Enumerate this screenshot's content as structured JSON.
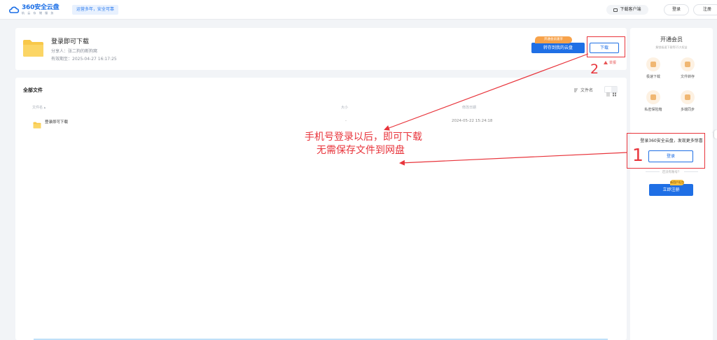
{
  "header": {
    "logo_text": "360安全云盘",
    "logo_sub": "杭 云 存 储 服 务",
    "slogan": "运营多年，安全可靠",
    "download_client": "下载客户端",
    "login_label": "登录",
    "register_label": "注册"
  },
  "share": {
    "title": "登录即可下载",
    "sharer": "分享人：张二狗的断狗窝",
    "expiry": "有效期至：2025-04-27 16:17:25",
    "vip_tag": "开通会员速享",
    "save_button": "转存到我的云盘",
    "download_button": "下载",
    "report": "举报"
  },
  "files": {
    "title": "全部文件",
    "sort_label": "文件名",
    "columns": [
      "文件名",
      "大小",
      "修改日期"
    ],
    "rows": [
      {
        "name": "登录即可下载",
        "size": "-",
        "date": "2024-05-22 15:24:18"
      }
    ]
  },
  "vip_panel": {
    "title": "开通会员",
    "subtitle": "解锁极速下载等15大权益",
    "features": [
      {
        "label": "极速下载",
        "icon": "download-speed-icon"
      },
      {
        "label": "文件转存",
        "icon": "file-transfer-icon"
      },
      {
        "label": "私密保险箱",
        "icon": "safe-box-icon"
      },
      {
        "label": "多端同步",
        "icon": "multi-device-sync-icon"
      }
    ]
  },
  "login_panel": {
    "tip": "登录360安全云盘，发现更多惊喜",
    "login_button": "登录",
    "register_tip": "还没有账号？",
    "register_button": "立即注册",
    "register_badge": "新用户礼包"
  },
  "annotations": {
    "text_line1": "手机号登录以后，即可下载",
    "text_line2": "无需保存文件到网盘",
    "number_1": "1",
    "number_2": "2",
    "color": "#e8343b"
  },
  "colors": {
    "accent": "#1f6fe5",
    "folder": "#f8c84a",
    "vip_orange": "#f7a24a"
  }
}
